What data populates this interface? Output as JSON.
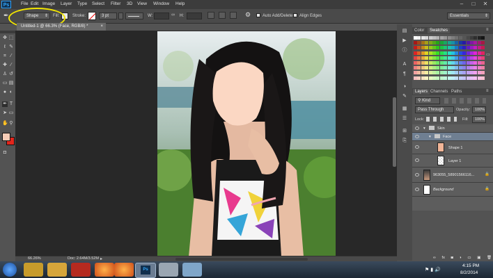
{
  "app": {
    "logo": "Ps"
  },
  "menu": [
    "File",
    "Edit",
    "Image",
    "Layer",
    "Type",
    "Select",
    "Filter",
    "3D",
    "View",
    "Window",
    "Help"
  ],
  "window_controls": [
    "–",
    "□",
    "✕"
  ],
  "options": {
    "mode_value": "Shape",
    "fill_label": "Fill:",
    "stroke_label": "Stroke:",
    "stroke_width": "3 pt",
    "w_label": "W:",
    "h_label": "H:",
    "auto_add_label": "Auto Add/Delete",
    "align_edges_label": "Align Edges",
    "workspace": "Essentials"
  },
  "document": {
    "tab_title": "Untitled-1 @ 66.3% (Face, RGB/8) *",
    "zoom": "66.26%",
    "doc_info": "Doc: 2.64M/3.52M"
  },
  "color_panel": {
    "tabs": [
      "Color",
      "Swatches"
    ]
  },
  "layers_panel": {
    "tabs": [
      "Layers",
      "Channels",
      "Paths"
    ],
    "kind_label": "Kind",
    "blend_mode": "Pass Through",
    "opacity_label": "Opacity:",
    "opacity_value": "100%",
    "lock_label": "Lock:",
    "fill_label": "Fill:",
    "fill_value": "100%",
    "layers": [
      {
        "name": "Skin",
        "type": "group"
      },
      {
        "name": "Face",
        "type": "group",
        "selected": true
      },
      {
        "name": "Shape 1",
        "type": "shape"
      },
      {
        "name": "Layer 1",
        "type": "layer"
      },
      {
        "name": "963055_58901566116...",
        "type": "image"
      },
      {
        "name": "Background",
        "type": "background"
      }
    ]
  },
  "taskbar": {
    "time": "4:15 PM",
    "date": "8/2/2014"
  },
  "colors": {
    "highlight_circle": "#f3e600",
    "foreground": "#f7cdb7",
    "background": "#e2261c",
    "face_fill": "#fbd7c3"
  }
}
